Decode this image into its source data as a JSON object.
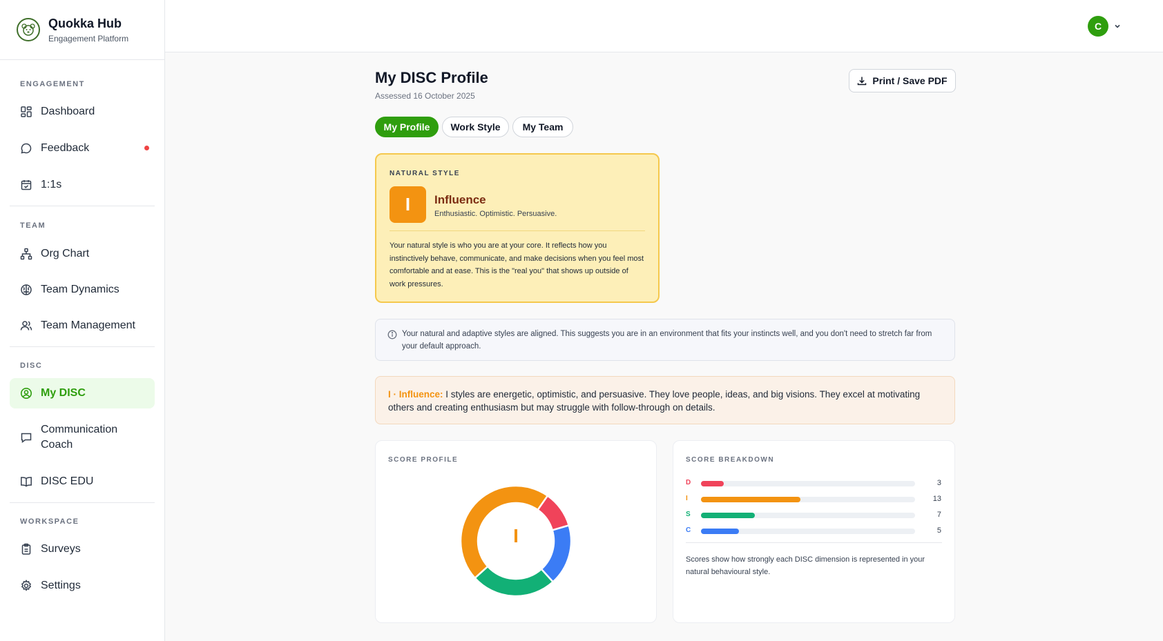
{
  "brand": {
    "title": "Quokka Hub",
    "subtitle": "Engagement Platform"
  },
  "sidebar": {
    "sections": [
      {
        "label": "ENGAGEMENT"
      },
      {
        "label": "TEAM"
      },
      {
        "label": "DISC"
      },
      {
        "label": "WORKSPACE"
      }
    ],
    "items": [
      {
        "label": "Dashboard",
        "icon": "grid-icon"
      },
      {
        "label": "Feedback",
        "icon": "chat-bubble-icon",
        "has_notification": true
      },
      {
        "label": "1:1s",
        "icon": "calendar-icon"
      },
      {
        "label": "Org Chart",
        "icon": "org-chart-icon"
      },
      {
        "label": "Team Dynamics",
        "icon": "brain-icon"
      },
      {
        "label": "Team Management",
        "icon": "users-icon"
      },
      {
        "label": "My DISC",
        "icon": "user-circle-icon",
        "active": true
      },
      {
        "label": "Communication Coach",
        "icon": "message-square-icon"
      },
      {
        "label": "DISC EDU",
        "icon": "book-open-icon"
      },
      {
        "label": "Surveys",
        "icon": "clipboard-icon"
      },
      {
        "label": "Settings",
        "icon": "gear-icon"
      }
    ]
  },
  "topbar": {
    "avatar_initial": "C"
  },
  "page": {
    "title": "My DISC Profile",
    "subtitle": "Assessed 16 October 2025",
    "print_label": "Print / Save PDF"
  },
  "tabs": [
    {
      "label": "My Profile",
      "active": true
    },
    {
      "label": "Work Style",
      "active": false
    },
    {
      "label": "My Team",
      "active": false
    }
  ],
  "natural_style": {
    "label": "NATURAL STYLE",
    "badge": "I",
    "title": "Influence",
    "traits": "Enthusiastic. Optimistic. Persuasive.",
    "description": "Your natural style is who you are at your core. It reflects how you instinctively behave, communicate, and make decisions when you feel most comfortable and at ease. This is the \"real you\" that shows up outside of work pressures."
  },
  "alignment_note": "Your natural and adaptive styles are aligned. This suggests you are in an environment that fits your instincts well, and you don't need to stretch far from your default approach.",
  "influence_summary": {
    "prefix": "I · Influence:",
    "text": " I styles are energetic, optimistic, and persuasive. They love people, ideas, and big visions. They excel at motivating others and creating enthusiasm but may struggle with follow-through on details."
  },
  "score_profile": {
    "label": "SCORE PROFILE",
    "center_letter": "I"
  },
  "score_breakdown": {
    "label": "SCORE BREAKDOWN",
    "note": "Scores show how strongly each DISC dimension is represented in your natural behavioural style."
  },
  "colors": {
    "D": "#f0435a",
    "I": "#f39311",
    "S": "#12b076",
    "C": "#3b7cf5",
    "accent": "#2f9e0e"
  },
  "chart_data": {
    "type": "pie",
    "categories": [
      "D",
      "I",
      "S",
      "C"
    ],
    "values": [
      3,
      13,
      7,
      5
    ],
    "max": 28
  }
}
